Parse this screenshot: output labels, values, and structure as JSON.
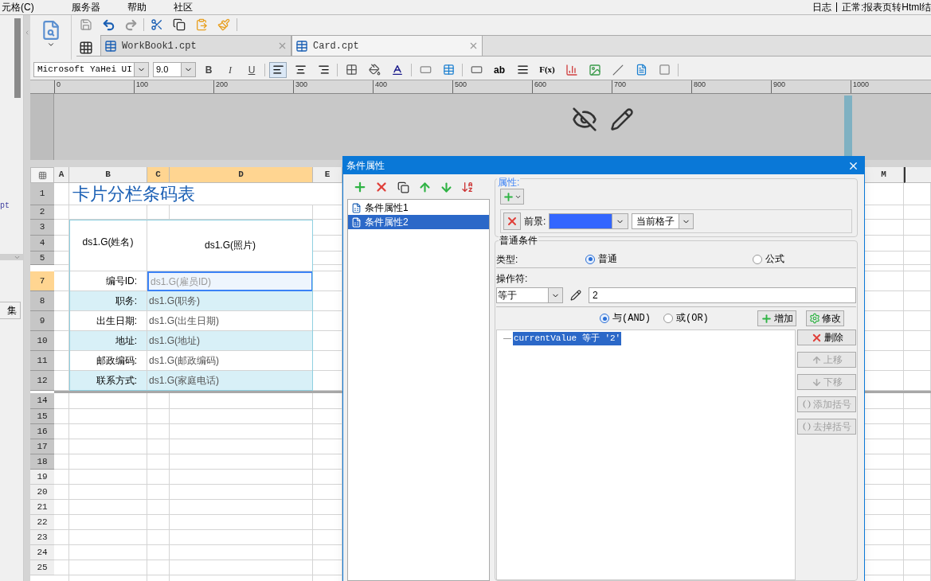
{
  "menu": [
    {
      "label": "元格(C)"
    },
    {
      "label": "服务器"
    },
    {
      "label": "帮助"
    },
    {
      "label": "社区"
    }
  ],
  "status": {
    "log": "日志",
    "message": "正常:报表页转Html结"
  },
  "left_panel": {
    "file_text": "pt",
    "button_text": "集"
  },
  "tabs": [
    {
      "label": "WorkBook1.cpt",
      "selected": false
    },
    {
      "label": "Card.cpt",
      "selected": true
    }
  ],
  "format_bar": {
    "font": "Microsoft YaHei UI",
    "size": "9.0",
    "style_buttons": [
      "B",
      "I",
      "U"
    ],
    "glyph_buttons": [
      "ab",
      "F(x)"
    ]
  },
  "ruler": {
    "ticks": [
      "0",
      "100",
      "200",
      "300",
      "400",
      "500",
      "600",
      "700",
      "800",
      "900",
      "1000"
    ]
  },
  "sheet": {
    "columns": [
      {
        "label": "A",
        "selected": false
      },
      {
        "label": "B",
        "selected": false
      },
      {
        "label": "C",
        "selected": true
      },
      {
        "label": "D",
        "selected": true
      },
      {
        "label": "E",
        "selected": false
      },
      {
        "label": "M",
        "selected": false
      }
    ],
    "rows": [
      {
        "label": "1",
        "selected": false,
        "shaded": true
      },
      {
        "label": "2",
        "selected": false,
        "shaded": true
      },
      {
        "label": "3",
        "selected": false,
        "shaded": true
      },
      {
        "label": "4",
        "selected": false,
        "shaded": true
      },
      {
        "label": "5",
        "selected": false,
        "shaded": true
      },
      {
        "label": "7",
        "selected": true,
        "shaded": true
      },
      {
        "label": "8",
        "selected": false,
        "shaded": true
      },
      {
        "label": "9",
        "selected": false,
        "shaded": true
      },
      {
        "label": "10",
        "selected": false,
        "shaded": true
      },
      {
        "label": "11",
        "selected": false,
        "shaded": true
      },
      {
        "label": "12",
        "selected": false,
        "shaded": true
      },
      {
        "label": "14",
        "selected": false,
        "shaded": true
      },
      {
        "label": "15",
        "selected": false,
        "shaded": true
      },
      {
        "label": "16",
        "selected": false,
        "shaded": true
      },
      {
        "label": "17",
        "selected": false,
        "shaded": true
      },
      {
        "label": "18",
        "selected": false,
        "shaded": true
      },
      {
        "label": "19",
        "selected": false,
        "shaded": false
      },
      {
        "label": "20",
        "selected": false,
        "shaded": false
      },
      {
        "label": "21",
        "selected": false,
        "shaded": false
      },
      {
        "label": "22",
        "selected": false,
        "shaded": false
      },
      {
        "label": "23",
        "selected": false,
        "shaded": false
      },
      {
        "label": "24",
        "selected": false,
        "shaded": false
      },
      {
        "label": "25",
        "selected": false,
        "shaded": false
      }
    ],
    "title": "卡片分栏条码表",
    "name_cell": "ds1.G(姓名)",
    "photo_cell": "ds1.G(照片)",
    "fields": [
      {
        "label": "编号ID:",
        "value": "ds1.G(雇员ID)",
        "highlighted": false,
        "selected": true
      },
      {
        "label": "职务:",
        "value": "ds1.G(职务)",
        "highlighted": true,
        "selected": false
      },
      {
        "label": "出生日期:",
        "value": "ds1.G(出生日期)",
        "highlighted": false,
        "selected": false
      },
      {
        "label": "地址:",
        "value": "ds1.G(地址)",
        "highlighted": true,
        "selected": false
      },
      {
        "label": "邮政编码:",
        "value": "ds1.G(邮政编码)",
        "highlighted": false,
        "selected": false
      },
      {
        "label": "联系方式:",
        "value": "ds1.G(家庭电话)",
        "highlighted": true,
        "selected": false
      }
    ]
  },
  "dialog": {
    "title": "条件属性",
    "conditions": [
      {
        "label": "条件属性1",
        "selected": false
      },
      {
        "label": "条件属性2",
        "selected": true
      }
    ],
    "attributes_title": "属性:",
    "foreground": {
      "label": "前景:",
      "color": "#3366ff"
    },
    "scope": "当前格子",
    "general_title": "普通条件",
    "type_label": "类型:",
    "type_options": [
      {
        "label": "普通",
        "selected": true
      },
      {
        "label": "公式",
        "selected": false
      }
    ],
    "operator_label": "操作符:",
    "operator": "等于",
    "value": "2",
    "logic_options": [
      {
        "label": "与(AND)",
        "selected": true
      },
      {
        "label": "或(OR)",
        "selected": false
      }
    ],
    "add_label": "增加",
    "modify_label": "修改",
    "formulas": [
      {
        "text": "currentValue 等于 '2'",
        "selected": true
      }
    ],
    "side_buttons": [
      {
        "label": "删除",
        "disabled": false
      },
      {
        "label": "上移",
        "disabled": true
      },
      {
        "label": "下移",
        "disabled": true
      },
      {
        "label": "添加括号",
        "disabled": true
      },
      {
        "label": "去掉括号",
        "disabled": true
      }
    ]
  }
}
